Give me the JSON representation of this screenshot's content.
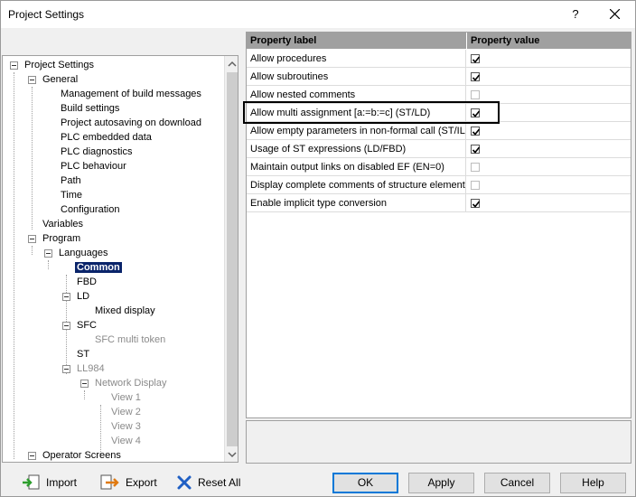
{
  "window": {
    "title": "Project Settings",
    "help_label": "?"
  },
  "tree": {
    "nodes": [
      {
        "label": "Project Settings"
      },
      {
        "label": "General"
      },
      {
        "label": "Management of build messages"
      },
      {
        "label": "Build settings"
      },
      {
        "label": "Project autosaving on download"
      },
      {
        "label": "PLC embedded data"
      },
      {
        "label": "PLC diagnostics"
      },
      {
        "label": "PLC behaviour"
      },
      {
        "label": "Path"
      },
      {
        "label": "Time"
      },
      {
        "label": "Configuration"
      },
      {
        "label": "Variables"
      },
      {
        "label": "Program"
      },
      {
        "label": "Languages"
      },
      {
        "label": "Common"
      },
      {
        "label": "FBD"
      },
      {
        "label": "LD"
      },
      {
        "label": "Mixed display"
      },
      {
        "label": "SFC"
      },
      {
        "label": "SFC multi token"
      },
      {
        "label": "ST"
      },
      {
        "label": "LL984"
      },
      {
        "label": "Network Display"
      },
      {
        "label": "View 1"
      },
      {
        "label": "View 2"
      },
      {
        "label": "View 3"
      },
      {
        "label": "View 4"
      },
      {
        "label": "Operator Screens"
      }
    ]
  },
  "grid": {
    "col_label": "Property label",
    "col_value": "Property value",
    "rows": [
      {
        "label": "Allow procedures",
        "checked": true
      },
      {
        "label": "Allow subroutines",
        "checked": true
      },
      {
        "label": "Allow nested comments",
        "checked": false
      },
      {
        "label": "Allow multi assignment [a:=b:=c] (ST/LD)",
        "checked": true
      },
      {
        "label": "Allow empty parameters in non-formal call (ST/IL)",
        "checked": true
      },
      {
        "label": "Usage of ST expressions (LD/FBD)",
        "checked": true
      },
      {
        "label": "Maintain output links on disabled EF (EN=0)",
        "checked": false
      },
      {
        "label": "Display complete comments of structure element",
        "checked": false
      },
      {
        "label": "Enable implicit type conversion",
        "checked": true
      }
    ]
  },
  "toolbar": {
    "import_label": "Import",
    "export_label": "Export",
    "reset_label": "Reset All"
  },
  "buttons": {
    "ok": "OK",
    "apply": "Apply",
    "cancel": "Cancel",
    "help": "Help"
  }
}
